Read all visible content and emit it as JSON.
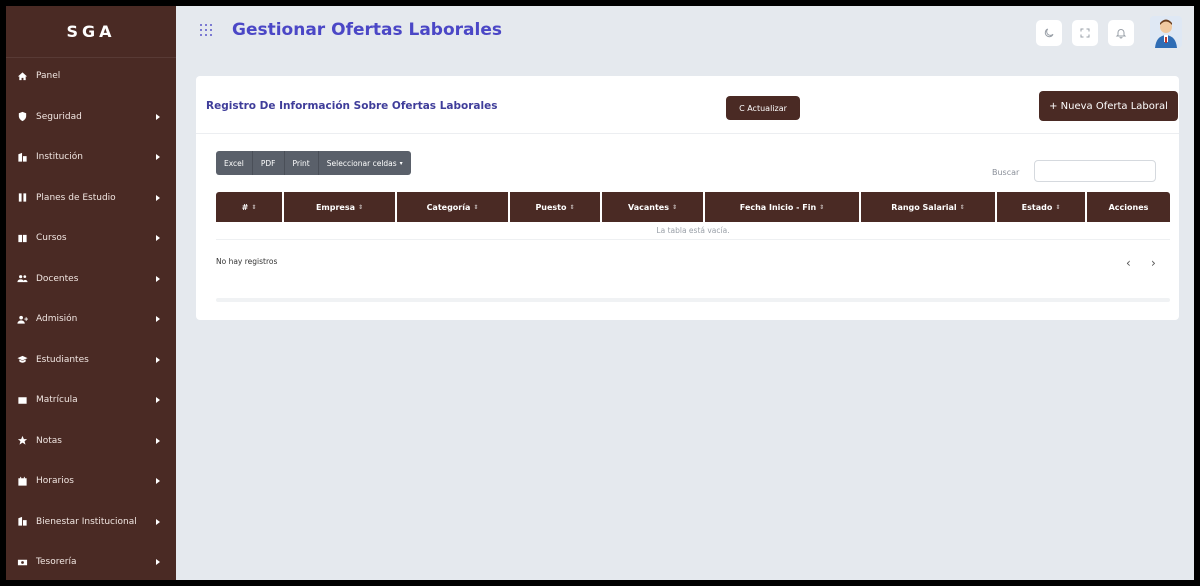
{
  "sidebar": {
    "brand": "SGA",
    "items": [
      {
        "label": "Panel",
        "icon": "home-icon",
        "arrow": false
      },
      {
        "label": "Seguridad",
        "icon": "shield-icon",
        "arrow": true
      },
      {
        "label": "Institución",
        "icon": "building-icon",
        "arrow": true
      },
      {
        "label": "Planes de Estudio",
        "icon": "book-icon",
        "arrow": true
      },
      {
        "label": "Cursos",
        "icon": "book-open-icon",
        "arrow": true
      },
      {
        "label": "Docentes",
        "icon": "users-icon",
        "arrow": true
      },
      {
        "label": "Admisión",
        "icon": "user-plus-icon",
        "arrow": true
      },
      {
        "label": "Estudiantes",
        "icon": "graduation-cap-icon",
        "arrow": true
      },
      {
        "label": "Matrícula",
        "icon": "id-card-icon",
        "arrow": true
      },
      {
        "label": "Notas",
        "icon": "star-icon",
        "arrow": true
      },
      {
        "label": "Horarios",
        "icon": "calendar-icon",
        "arrow": true
      },
      {
        "label": "Bienestar Institucional",
        "icon": "building-icon",
        "arrow": true
      },
      {
        "label": "Tesorería",
        "icon": "money-icon",
        "arrow": true
      }
    ]
  },
  "header": {
    "title": "Gestionar Ofertas Laborales",
    "buttons": [
      "moon-icon",
      "fullscreen-icon",
      "bell-icon"
    ],
    "avatar": "user-avatar"
  },
  "card": {
    "title": "Registro De Información Sobre Ofertas Laborales",
    "refresh_label": "C Actualizar",
    "new_label": "+ Nueva Oferta Laboral",
    "export_buttons": [
      "Excel",
      "PDF",
      "Print",
      "Seleccionar celdas"
    ],
    "search_label": "Buscar",
    "search_value": "",
    "columns": [
      "#",
      "Empresa",
      "Categoría",
      "Puesto",
      "Vacantes",
      "Fecha Inicio - Fin",
      "Rango Salarial",
      "Estado",
      "Acciones"
    ],
    "empty_text": "La tabla está vacía.",
    "info_text": "No hay registros",
    "prev": "‹",
    "next": "›"
  },
  "colors": {
    "brand_brown": "#4a2a24",
    "title_purple": "#4b47c6",
    "background": "#e5e9ee"
  }
}
